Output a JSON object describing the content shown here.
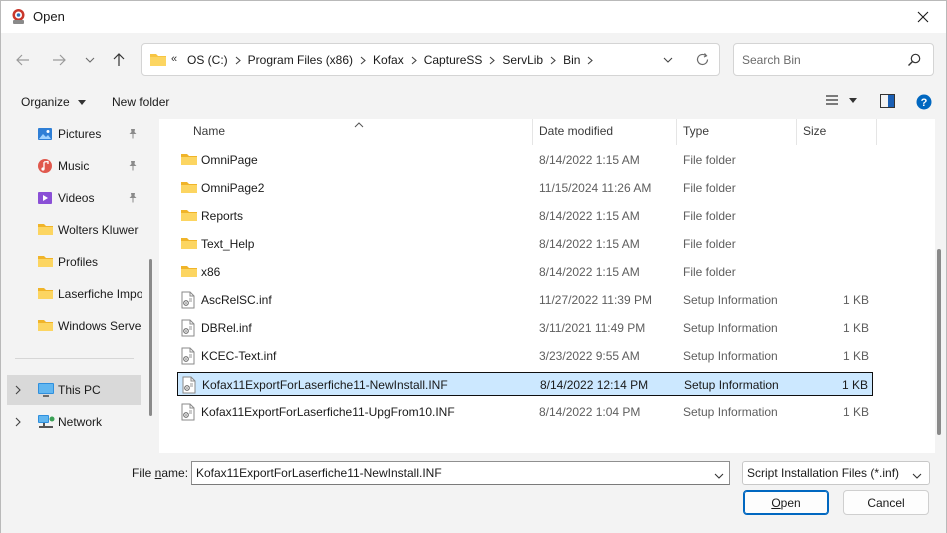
{
  "window": {
    "title": "Open"
  },
  "address": {
    "overflow": "«",
    "crumbs": [
      "OS (C:)",
      "Program Files (x86)",
      "Kofax",
      "CaptureSS",
      "ServLib",
      "Bin"
    ]
  },
  "search": {
    "placeholder": "Search Bin"
  },
  "toolbar": {
    "organize": "Organize",
    "new_folder": "New folder"
  },
  "sidebar": {
    "items": [
      {
        "label": "Pictures",
        "icon": "pictures-icon",
        "pinned": true
      },
      {
        "label": "Music",
        "icon": "music-icon",
        "pinned": true
      },
      {
        "label": "Videos",
        "icon": "videos-icon",
        "pinned": true
      },
      {
        "label": "Wolters Kluwer",
        "icon": "folder-icon"
      },
      {
        "label": "Profiles",
        "icon": "folder-icon"
      },
      {
        "label": "Laserfiche Impo",
        "icon": "folder-icon"
      },
      {
        "label": "Windows Server",
        "icon": "folder-icon"
      }
    ],
    "this_pc": "This PC",
    "network": "Network"
  },
  "columns": {
    "name": "Name",
    "date": "Date modified",
    "type": "Type",
    "size": "Size"
  },
  "files": [
    {
      "name": "OmniPage",
      "date": "8/14/2022 1:15 AM",
      "type": "File folder",
      "size": "",
      "kind": "folder"
    },
    {
      "name": "OmniPage2",
      "date": "11/15/2024 11:26 AM",
      "type": "File folder",
      "size": "",
      "kind": "folder"
    },
    {
      "name": "Reports",
      "date": "8/14/2022 1:15 AM",
      "type": "File folder",
      "size": "",
      "kind": "folder"
    },
    {
      "name": "Text_Help",
      "date": "8/14/2022 1:15 AM",
      "type": "File folder",
      "size": "",
      "kind": "folder"
    },
    {
      "name": "x86",
      "date": "8/14/2022 1:15 AM",
      "type": "File folder",
      "size": "",
      "kind": "folder"
    },
    {
      "name": "AscRelSC.inf",
      "date": "11/27/2022 11:39 PM",
      "type": "Setup Information",
      "size": "1 KB",
      "kind": "file"
    },
    {
      "name": "DBRel.inf",
      "date": "3/11/2021 11:49 PM",
      "type": "Setup Information",
      "size": "1 KB",
      "kind": "file"
    },
    {
      "name": "KCEC-Text.inf",
      "date": "3/23/2022 9:55 AM",
      "type": "Setup Information",
      "size": "1 KB",
      "kind": "file"
    },
    {
      "name": "Kofax11ExportForLaserfiche11-NewInstall.INF",
      "date": "8/14/2022 12:14 PM",
      "type": "Setup Information",
      "size": "1 KB",
      "kind": "file",
      "selected": true
    },
    {
      "name": "Kofax11ExportForLaserfiche11-UpgFrom10.INF",
      "date": "8/14/2022 1:04 PM",
      "type": "Setup Information",
      "size": "1 KB",
      "kind": "file"
    }
  ],
  "bottom": {
    "file_name_label_pre": "File ",
    "file_name_label_key": "n",
    "file_name_label_post": "ame:",
    "file_name_value": "Kofax11ExportForLaserfiche11-NewInstall.INF",
    "file_type": "Script Installation Files (*.inf)",
    "open_key": "O",
    "open_rest": "pen",
    "cancel": "Cancel"
  },
  "colors": {
    "accent": "#0067c0",
    "selection": "#cce8ff",
    "folder": "#f7c543"
  }
}
